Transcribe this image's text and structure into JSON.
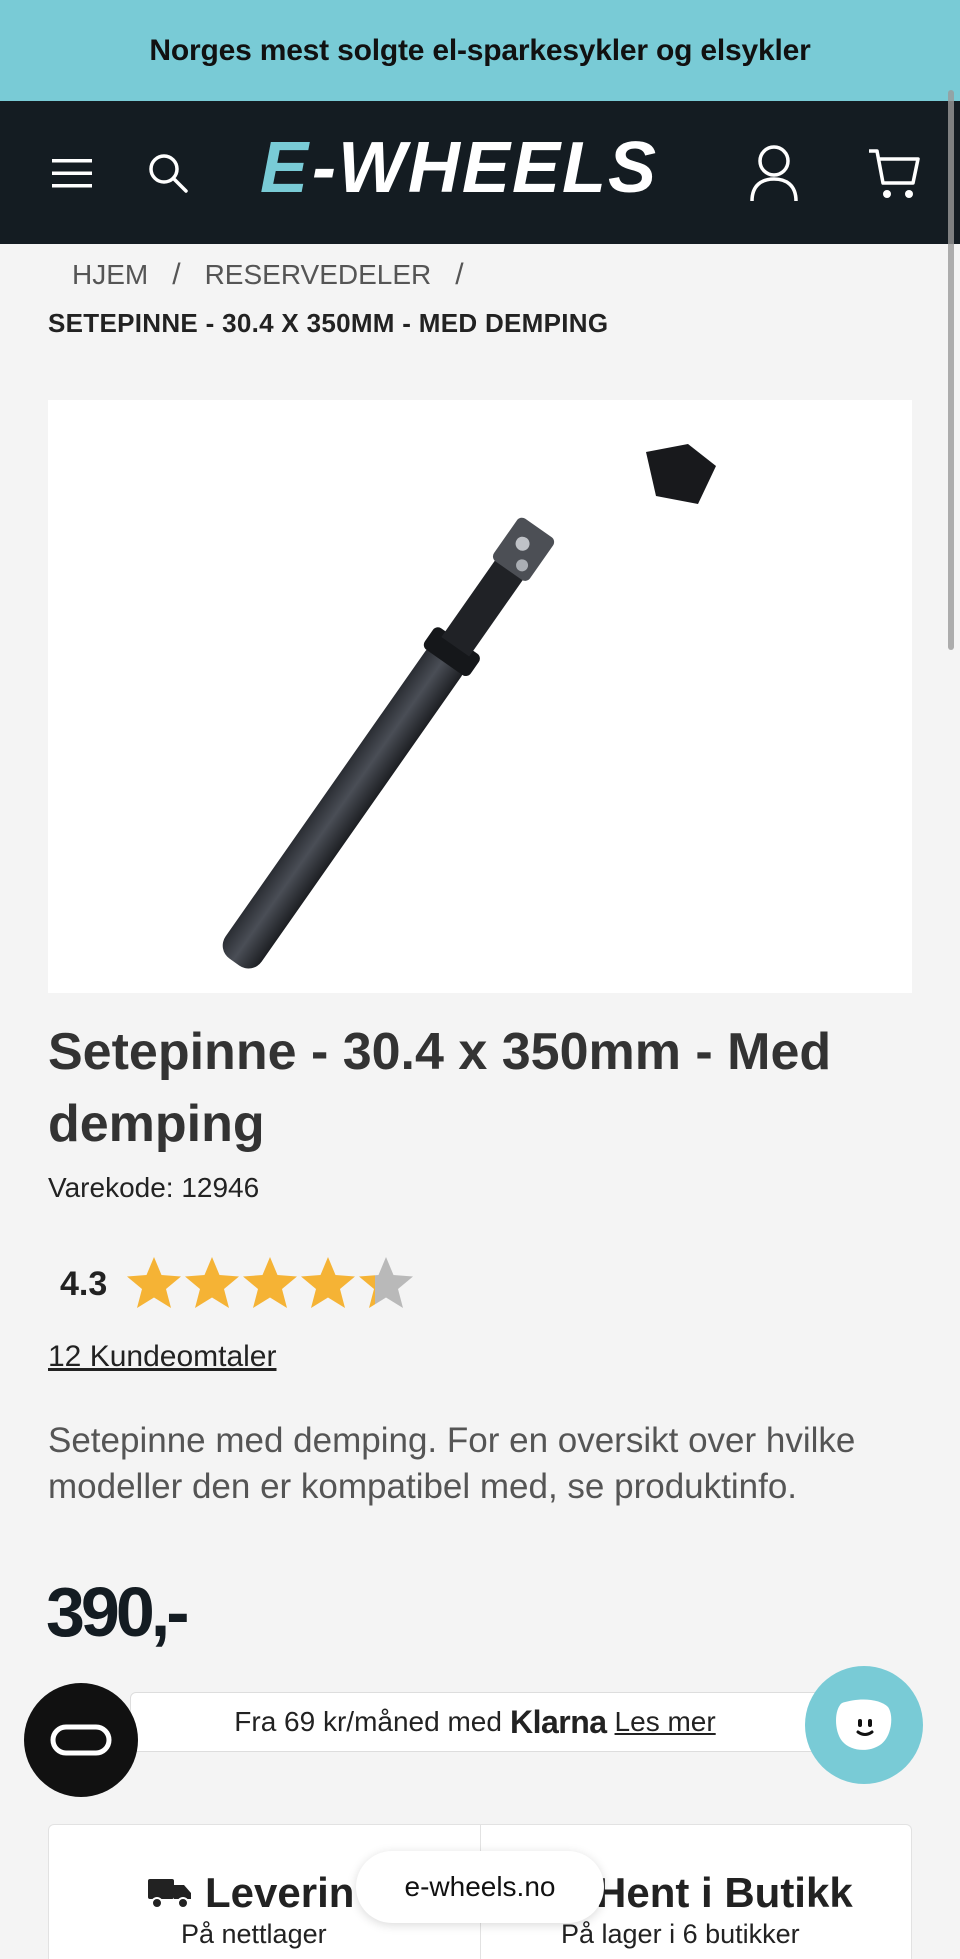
{
  "banner": {
    "text": "Norges mest solgte el-sparkesykler og elsykler"
  },
  "header": {
    "logo_text": "E-WHEELS"
  },
  "breadcrumb": {
    "items": [
      "HJEM",
      "RESERVEDELER"
    ],
    "separator": "/",
    "current": "SETEPINNE - 30.4 X 350MM - MED DEMPING"
  },
  "product": {
    "title": "Setepinne - 30.4 x 350mm - Med demping",
    "sku_label": "Varekode:",
    "sku_value": "12946",
    "rating_value": "4.3",
    "rating_fraction": 0.86,
    "reviews_link": "12 Kundeomtaler",
    "description": "Setepinne med demping. For en oversikt over hvilke modeller den er kompatibel med, se produktinfo.",
    "price": "390,-"
  },
  "klarna": {
    "prefix": "Fra 69 kr/måned med",
    "brand": "Klarna",
    "link": "Les mer"
  },
  "delivery": {
    "left_title": "Leverin",
    "left_sub": "På nettlager",
    "right_title": "Hent i Butikk",
    "right_sub": "På lager i 6 butikker"
  },
  "browser": {
    "url": "e-wheels.no"
  },
  "colors": {
    "banner": "#79cbd6",
    "header": "#141c22",
    "accent": "#79cbd6",
    "star": "#f5b335"
  }
}
